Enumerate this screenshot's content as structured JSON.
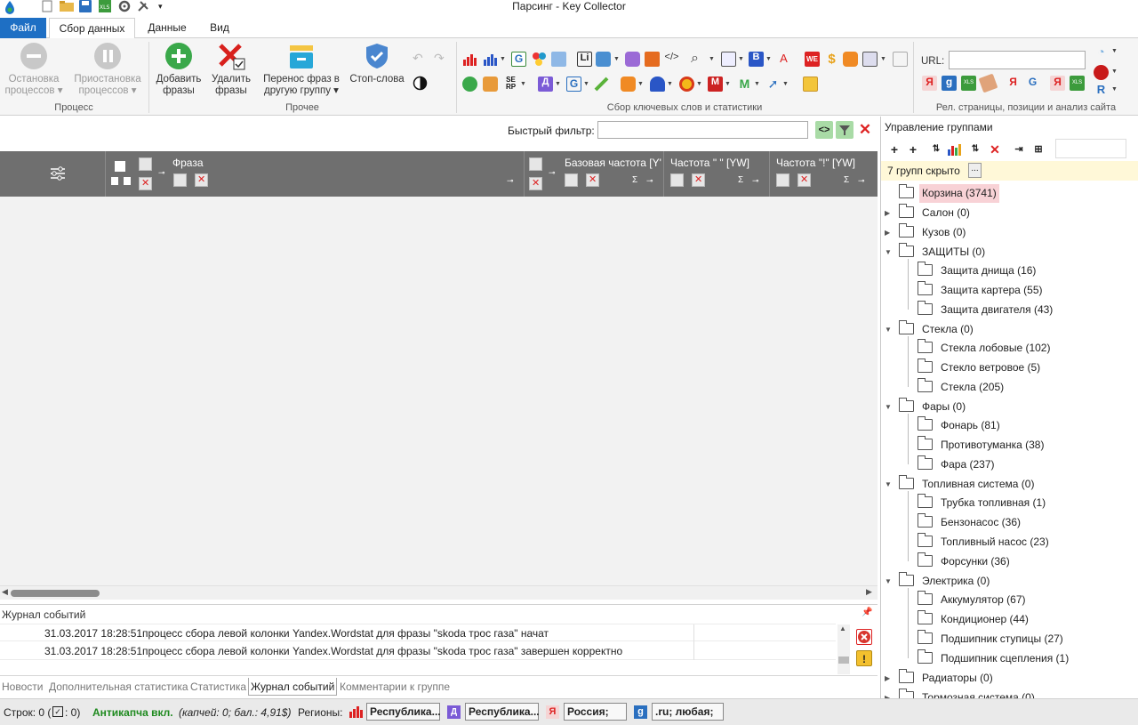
{
  "window": {
    "title": "Парсинг - Key Collector"
  },
  "ribbon_tabs": [
    {
      "label": "Файл"
    },
    {
      "label": "Сбор данных"
    },
    {
      "label": "Данные"
    },
    {
      "label": "Вид"
    }
  ],
  "ribbon": {
    "stop_processes": {
      "line1": "Остановка",
      "line2": "процессов"
    },
    "pause_processes": {
      "line1": "Приостановка",
      "line2": "процессов"
    },
    "add_phrases": {
      "line1": "Добавить",
      "line2": "фразы"
    },
    "delete_phrases": {
      "line1": "Удалить",
      "line2": "фразы"
    },
    "move_phrases": {
      "line1": "Перенос фраз в",
      "line2": "другую группу"
    },
    "stop_words": {
      "label": "Стоп-слова"
    },
    "groups": {
      "process": "Процесс",
      "other": "Прочее",
      "keywords": "Сбор ключевых слов и статистики",
      "relevance": "Рел. страницы, позиции и анализ сайта"
    },
    "url_label": "URL:",
    "url_value": ""
  },
  "quick_filter": {
    "label": "Быстрый фильтр:",
    "value": ""
  },
  "grid": {
    "columns": [
      {
        "name": "Фраза"
      },
      {
        "name": "Базовая частота [Y'"
      },
      {
        "name": "Частота \" \" [YW]"
      },
      {
        "name": "Частота \"!\" [YW]"
      }
    ],
    "sigma": "Σ"
  },
  "event_log": {
    "title": "Журнал событий",
    "rows": [
      {
        "time": "31.03.2017 18:28:51",
        "message": "процесс сбора левой колонки Yandex.Wordstat для фразы \"skoda трос газа\" начат"
      },
      {
        "time": "31.03.2017 18:28:51",
        "message": "процесс сбора левой колонки Yandex.Wordstat для фразы \"skoda трос газа\" завершен корректно"
      }
    ]
  },
  "bottom_tabs": [
    {
      "label": "Новости"
    },
    {
      "label": "Дополнительная статистика"
    },
    {
      "label": "Статистика"
    },
    {
      "label": "Журнал событий"
    },
    {
      "label": "Комментарии к группе"
    }
  ],
  "status": {
    "rows_prefix": "Строк: 0 (",
    "rows_suffix": ": 0)",
    "anticaptcha": "Антикапча вкл.",
    "captcha_info": "(капчей: 0; бал.: 4,91$)",
    "regions_label": "Регионы:",
    "regions": [
      "Республика...",
      "Республика...",
      "Россия; .ru;",
      ".ru; любая; ..."
    ]
  },
  "groups_panel": {
    "title": "Управление группами",
    "hidden_label": "7 групп скрыто",
    "hidden_btn": "...",
    "tree": [
      {
        "label": "Корзина (3741)"
      },
      {
        "label": "Салон (0)"
      },
      {
        "label": "Кузов (0)"
      },
      {
        "label": "ЗАЩИТЫ (0)"
      },
      {
        "label": "Защита днища (16)"
      },
      {
        "label": "Защита картера (55)"
      },
      {
        "label": "Защита двигателя (43)"
      },
      {
        "label": "Стекла (0)"
      },
      {
        "label": "Стекла лобовые (102)"
      },
      {
        "label": "Стекло ветровое (5)"
      },
      {
        "label": "Стекла (205)"
      },
      {
        "label": "Фары (0)"
      },
      {
        "label": "Фонарь (81)"
      },
      {
        "label": "Противотуманка (38)"
      },
      {
        "label": "Фара (237)"
      },
      {
        "label": "Топливная система (0)"
      },
      {
        "label": "Трубка топливная (1)"
      },
      {
        "label": "Бензонасос (36)"
      },
      {
        "label": "Топливный насос (23)"
      },
      {
        "label": "Форсунки (36)"
      },
      {
        "label": "Электрика (0)"
      },
      {
        "label": "Аккумулятор (67)"
      },
      {
        "label": "Кондиционер (44)"
      },
      {
        "label": "Подшипник ступицы (27)"
      },
      {
        "label": "Подшипник сцепления (1)"
      },
      {
        "label": "Радиаторы (0)"
      },
      {
        "label": "Тормозная система (0)"
      }
    ]
  },
  "colors": {
    "accent": "#1e6fc4",
    "grid_header": "#6f6f6f",
    "selected_group": "#f8d2d6",
    "anticaptcha": "#1f8a1f"
  }
}
